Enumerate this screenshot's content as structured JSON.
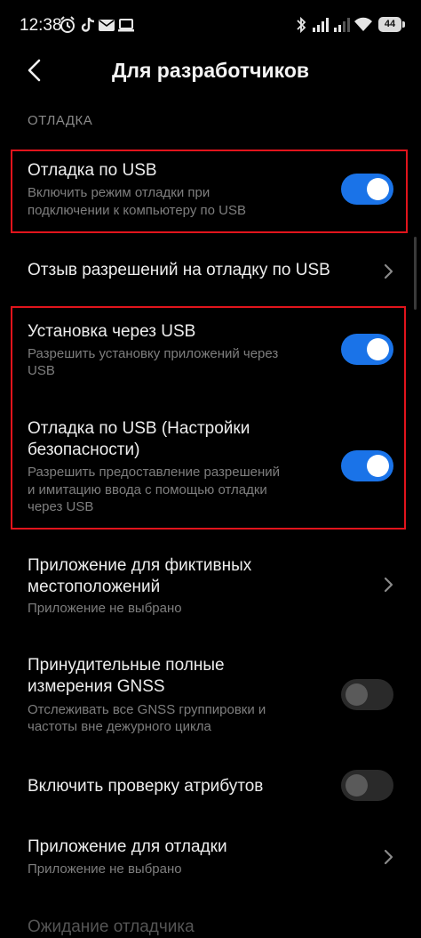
{
  "status_bar": {
    "time": "12:38",
    "battery": "44",
    "icons_left": [
      "alarm-icon",
      "tiktok-icon",
      "mail-icon",
      "laptop-icon"
    ],
    "icons_right": [
      "bluetooth-icon",
      "signal-icon",
      "signal-icon",
      "wifi-icon",
      "battery-icon"
    ]
  },
  "header": {
    "title": "Для разработчиков"
  },
  "section": {
    "label": "ОТЛАДКА"
  },
  "items": [
    {
      "title": "Отладка по USB",
      "subtitle": "Включить режим отладки при подключении к компьютеру по USB",
      "sub_line1": "Включить режим отладки при",
      "sub_line2": "подключении к компьютеру по USB",
      "control": "toggle",
      "state": "on"
    },
    {
      "title": "Отзыв разрешений на отладку по USB",
      "control": "chevron"
    },
    {
      "title": "Установка через USB",
      "sub_line1": "Разрешить установку приложений через",
      "sub_line2": "USB",
      "control": "toggle",
      "state": "on"
    },
    {
      "title_line1": "Отладка по USB (Настройки",
      "title_line2": "безопасности)",
      "sub_line1": "Разрешить предоставление разрешений",
      "sub_line2": "и имитацию ввода с помощью отладки",
      "sub_line3": "через USB",
      "control": "toggle",
      "state": "on"
    },
    {
      "title_line1": "Приложение для фиктивных",
      "title_line2": "местоположений",
      "sub_line1": "Приложение не выбрано",
      "control": "chevron"
    },
    {
      "title_line1": "Принудительные полные",
      "title_line2": "измерения GNSS",
      "sub_line1": "Отслеживать все GNSS группировки и",
      "sub_line2": "частоты вне дежурного цикла",
      "control": "toggle",
      "state": "off"
    },
    {
      "title": "Включить проверку атрибутов",
      "control": "toggle",
      "state": "off"
    },
    {
      "title": "Приложение для отладки",
      "sub_line1": "Приложение не выбрано",
      "control": "chevron"
    },
    {
      "title": "Ожидание отладчика",
      "disabled": true
    }
  ],
  "colors": {
    "background": "#000000",
    "toggle_on": "#1a73e8",
    "toggle_off": "#2a2a2a",
    "highlight": "#e1141c",
    "subtitle": "#7e7e7e"
  }
}
